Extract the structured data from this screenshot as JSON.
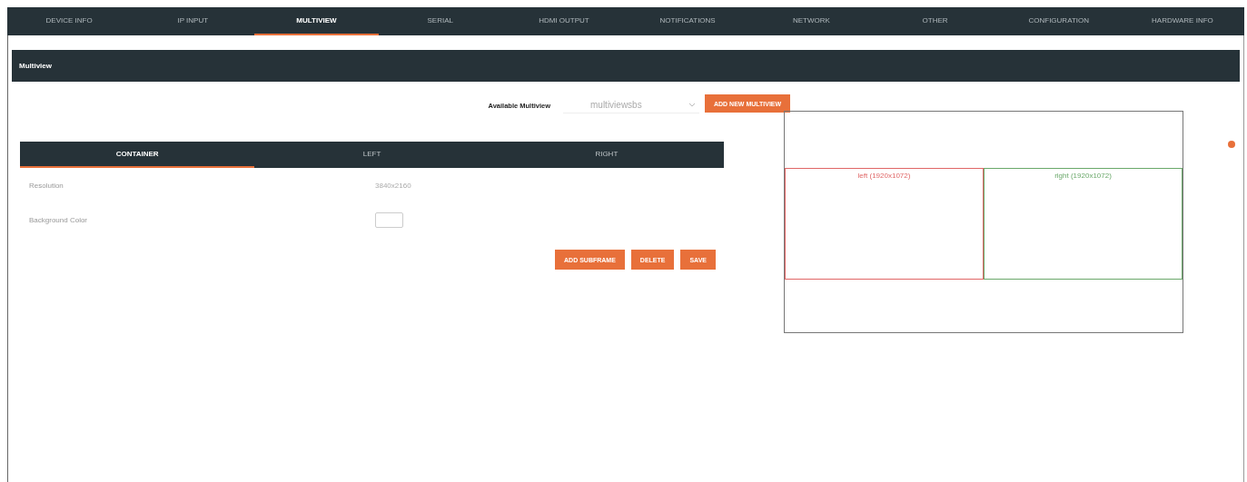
{
  "tabs": [
    {
      "label": "DEVICE INFO",
      "selected": false
    },
    {
      "label": "IP INPUT",
      "selected": false
    },
    {
      "label": "MULTIVIEW",
      "selected": true
    },
    {
      "label": "SERIAL",
      "selected": false
    },
    {
      "label": "HDMI OUTPUT",
      "selected": false
    },
    {
      "label": "NOTIFICATIONS",
      "selected": false
    },
    {
      "label": "NETWORK",
      "selected": false
    },
    {
      "label": "OTHER",
      "selected": false
    },
    {
      "label": "CONFIGURATION",
      "selected": false
    },
    {
      "label": "HARDWARE INFO",
      "selected": false
    }
  ],
  "section": {
    "title": "Multiview"
  },
  "selector": {
    "label": "Available Multiview",
    "value": "multiviewsbs",
    "button": "ADD NEW MULTIVIEW"
  },
  "subtabs": [
    {
      "label": "CONTAINER",
      "selected": true
    },
    {
      "label": "LEFT",
      "selected": false
    },
    {
      "label": "RIGHT",
      "selected": false
    }
  ],
  "fields": [
    {
      "kind": "text",
      "label": "Resolution",
      "value": "3840x2160"
    },
    {
      "kind": "color",
      "label": "Background Color"
    }
  ],
  "actions": [
    "ADD SUBFRAME",
    "DELETE",
    "SAVE"
  ],
  "preview": {
    "frames": [
      {
        "label": "left (1920x1072)",
        "color": "#e06666"
      },
      {
        "label": "right (1920x1072)",
        "color": "#6aa86a"
      }
    ]
  }
}
